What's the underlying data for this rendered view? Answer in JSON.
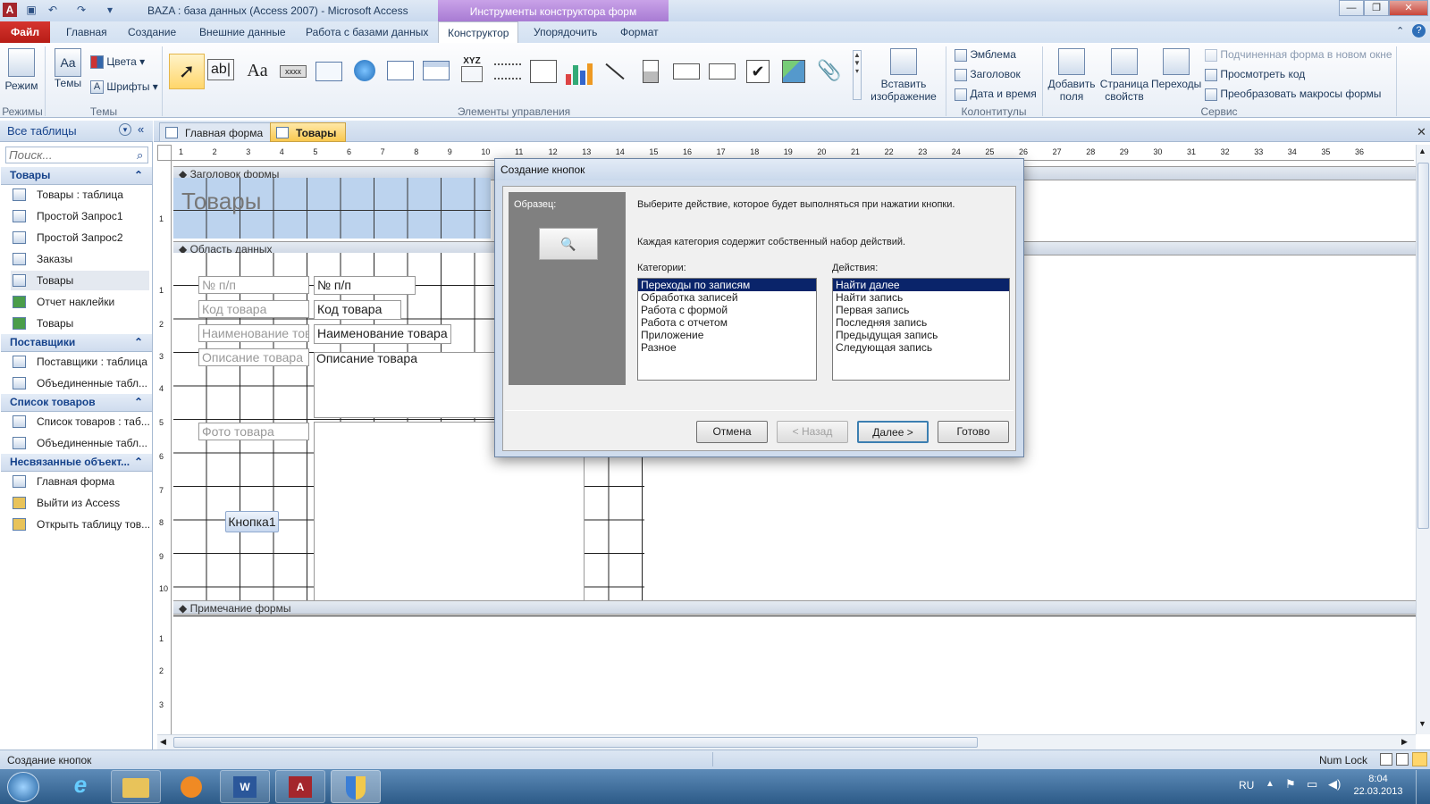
{
  "window": {
    "title": "BAZA : база данных (Access 2007)  -  Microsoft Access",
    "context_tab_title": "Инструменты конструктора форм"
  },
  "tabs": {
    "file": "Файл",
    "items": [
      "Главная",
      "Создание",
      "Внешние данные",
      "Работа с базами данных",
      "Конструктор",
      "Упорядочить",
      "Формат"
    ]
  },
  "ribbon": {
    "mode": "Режим",
    "themes": "Темы",
    "colors": "Цвета",
    "fonts": "Шрифты",
    "group_modes": "Режимы",
    "group_themes": "Темы",
    "group_controls": "Элементы управления",
    "insert_image": "Вставить изображение",
    "logo": "Эмблема",
    "header": "Заголовок",
    "datetime": "Дата и время",
    "group_headers": "Колонтитулы",
    "add_fields": "Добавить поля",
    "property_sheet": "Страница свойств",
    "tab_order": "Переходы",
    "subform_new_window": "Подчиненная форма в новом окне",
    "view_code": "Просмотреть код",
    "convert_macros": "Преобразовать макросы формы",
    "group_service": "Сервис"
  },
  "nav": {
    "header": "Все таблицы",
    "search_placeholder": "Поиск...",
    "groups": [
      {
        "title": "Товары",
        "items": [
          "Товары : таблица",
          "Простой Запрос1",
          "Простой Запрос2",
          "Заказы",
          "Товары",
          "Отчет наклейки",
          "Товары"
        ]
      },
      {
        "title": "Поставщики",
        "items": [
          "Поставщики : таблица",
          "Объединенные табл..."
        ]
      },
      {
        "title": "Список товаров",
        "items": [
          "Список товаров : таб...",
          "Объединенные табл..."
        ]
      },
      {
        "title": "Несвязанные объект...",
        "items": [
          "Главная форма",
          "Выйти из Access",
          "Открыть таблицу тов..."
        ]
      }
    ]
  },
  "doc_tabs": [
    "Главная форма",
    "Товары"
  ],
  "form": {
    "header_section": "Заголовок формы",
    "header_title": "Товары",
    "data_section": "Область данных",
    "footer_section": "Примечание формы",
    "labels": [
      "№ п/п",
      "Код товара",
      "Наименование това",
      "Описание товара",
      "Фото товара"
    ],
    "fields": [
      "№ п/п",
      "Код товара",
      "Наименование товара",
      "Описание товара"
    ],
    "button": "Кнопка1",
    "ruler_h": [
      "1",
      "2",
      "3",
      "4",
      "5",
      "6",
      "7",
      "8",
      "9",
      "10",
      "11",
      "12",
      "13",
      "14",
      "15",
      "16",
      "17",
      "18",
      "19",
      "20",
      "21",
      "22",
      "23",
      "24",
      "25",
      "26",
      "27",
      "28",
      "29",
      "30",
      "31",
      "32",
      "33",
      "34",
      "35",
      "36"
    ]
  },
  "dialog": {
    "title": "Создание кнопок",
    "sample_label": "Образец:",
    "instruction": "Выберите действие, которое будет выполняться при нажатии кнопки.",
    "note": "Каждая категория содержит собственный набор действий.",
    "categories_label": "Категории:",
    "actions_label": "Действия:",
    "categories": [
      "Переходы по записям",
      "Обработка записей",
      "Работа с формой",
      "Работа с отчетом",
      "Приложение",
      "Разное"
    ],
    "actions": [
      "Найти далее",
      "Найти запись",
      "Первая запись",
      "Последняя запись",
      "Предыдущая запись",
      "Следующая запись"
    ],
    "btn_cancel": "Отмена",
    "btn_back": "< Назад",
    "btn_next": "Далее >",
    "btn_finish": "Готово"
  },
  "status": {
    "left": "Создание кнопок",
    "numlock": "Num Lock"
  },
  "taskbar": {
    "lang": "RU",
    "time": "8:04",
    "date": "22.03.2013"
  }
}
